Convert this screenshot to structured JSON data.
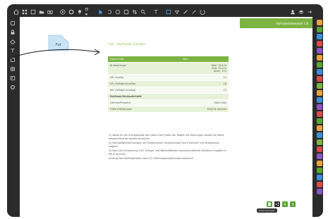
{
  "window": {
    "header_band": "Nahrwertelemente 1.8"
  },
  "toolbar": {
    "icons": [
      "home-icon",
      "grid-icon",
      "square-icon",
      "folder-icon",
      "camera-icon",
      "play-icon",
      "settings-icon",
      "pin-icon",
      "lock-icon",
      "text-icon",
      "cursor-icon",
      "undo-icon",
      "circle-icon",
      "shape-icon",
      "crop-icon",
      "zoom-icon",
      "color-icon",
      "hand-icon",
      "pen-icon",
      "brush-icon",
      "clock-icon",
      "chevron-icon"
    ],
    "zoom_text": "≡ ◂"
  },
  "sticky_note": {
    "label": "Fut"
  },
  "table": {
    "title": "Fut – wertvolle Zutaten",
    "headers": [
      "Eigenschaft",
      "Wert"
    ],
    "rows": [
      {
        "c1": "Bruttoenergie",
        "c2": "Total  34,0 %\nDuis  24,4 %\nAhdd   0 %"
      },
      {
        "c1": "ME, kcal/kg",
        "c2": "14"
      },
      {
        "c1": "ME, Geflügel (kcal/kg)",
        "c2": "16"
      },
      {
        "c1": "Ref. Geflügel (kcal/kg)",
        "c2": "15"
      },
      {
        "c1": "Rohfaser/Verdaulichkeit",
        "c2": ""
      },
      {
        "c1": "Calcium/Phosphor",
        "c2": "1000:1000"
      },
      {
        "c1": "Futtermittelgruppe",
        "c2": "Fett/Öle wertvoll"
      }
    ]
  },
  "notes": [
    "(1) Werte für den Energiegehalt des Futters nach Daten der Tabelle; bei Mischungen werden die Werte entsprechend der Anteile berechnet.",
    "(2) Nährstoffgehalte bezogen auf Trockenmasse; Schwankungen durch Herkunft und Verarbeitung möglich.",
    "(3) Nach DLG-Empfehlung 2011 Energie- und Nährstoffbedarf landwirtschaftlicher Nutztiere; Angaben in ME je kg Futter.",
    "Achtung: Bei Rohfettgehalten über 6 % Fütterungsempfehlungen beachten."
  ],
  "bottom_tools": {
    "tooltip": "Seite wechseln"
  }
}
